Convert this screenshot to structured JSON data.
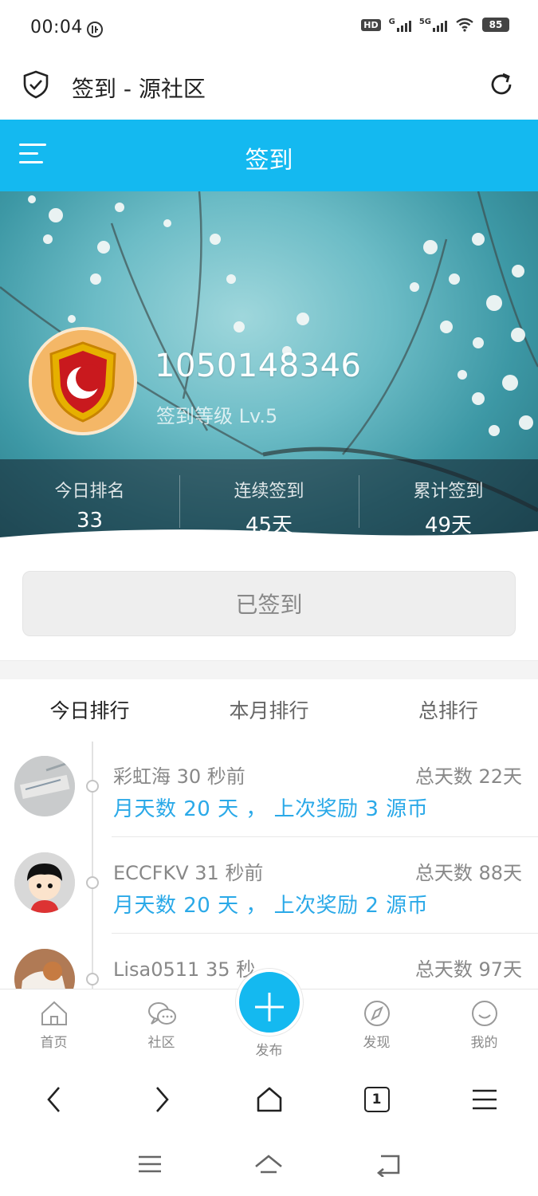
{
  "status_bar": {
    "time": "00:04",
    "hd_label": "HD",
    "net_g": "G",
    "net_5g": "5G",
    "battery": "85"
  },
  "browser": {
    "title": "签到 - 源社区"
  },
  "header": {
    "title": "签到"
  },
  "profile": {
    "username": "1050148346",
    "level": "签到等级 Lv.5"
  },
  "stats": [
    {
      "label": "今日排名",
      "value": "33"
    },
    {
      "label": "连续签到",
      "value": "45天"
    },
    {
      "label": "累计签到",
      "value": "49天"
    }
  ],
  "sign_button": "已签到",
  "tabs": [
    "今日排行",
    "本月排行",
    "总排行"
  ],
  "ranking": [
    {
      "name_time": "彩虹海 30 秒前",
      "total": "总天数 22天",
      "detail": "月天数 20 天 ， 上次奖励 3 源币"
    },
    {
      "name_time": "ECCFKV 31 秒前",
      "total": "总天数 88天",
      "detail": "月天数 20 天 ， 上次奖励 2 源币"
    },
    {
      "name_time": "Lisa0511 35 秒",
      "total": "总天数 97天",
      "detail": ""
    }
  ],
  "bottom_nav": [
    {
      "label": "首页",
      "icon": "home-icon"
    },
    {
      "label": "社区",
      "icon": "chat-icon"
    },
    {
      "label": "发布",
      "icon": "plus-icon"
    },
    {
      "label": "发现",
      "icon": "compass-icon"
    },
    {
      "label": "我的",
      "icon": "smile-icon"
    }
  ],
  "browser_nav": {
    "tab_count": "1"
  },
  "colors": {
    "accent": "#14b9f0",
    "link": "#2aa9e8"
  }
}
